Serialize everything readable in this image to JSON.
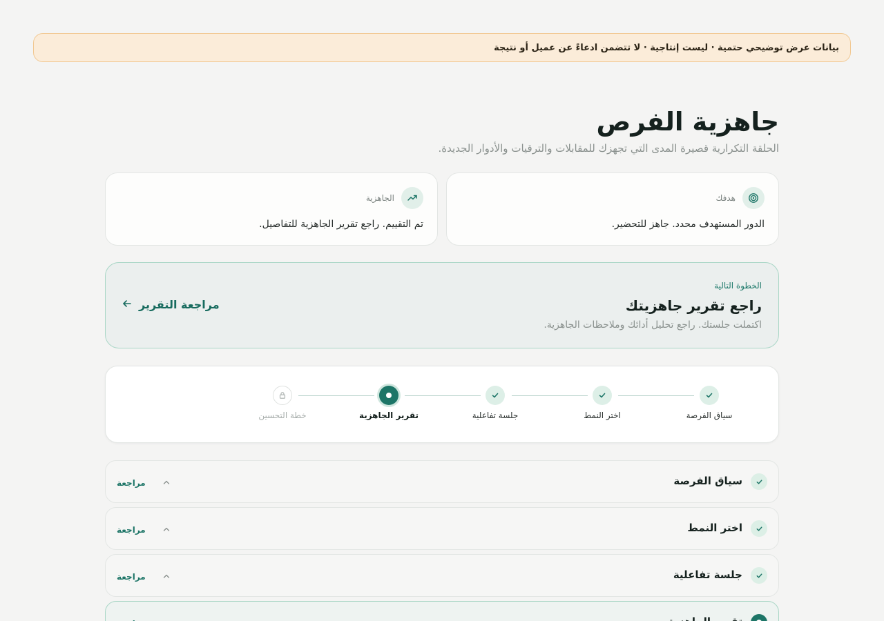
{
  "banner": {
    "text": "بيانات عرض توضيحي حتمية · ليست إنتاجية · لا تتضمن ادعاءً عن عميل أو نتيجة"
  },
  "header": {
    "title": "جاهزية الفرص",
    "subtitle": "الحلقة التكرارية قصيرة المدى التي تجهزك للمقابلات والترقيات والأدوار الجديدة."
  },
  "cards": {
    "goal": {
      "label": "هدفك",
      "body": "الدور المستهدف محدد. جاهز للتحضير.",
      "icon": "target-icon"
    },
    "readiness": {
      "label": "الجاهزية",
      "body": "تم التقييم. راجع تقرير الجاهزية للتفاصيل.",
      "icon": "trending-up-icon"
    }
  },
  "next_step": {
    "eyebrow": "الخطوة التالية",
    "title": "راجع تقرير جاهزيتك",
    "description": "اكتملت جلستك. راجع تحليل أدائك وملاحظات الجاهزية.",
    "action_label": "مراجعة التقرير"
  },
  "stepper": {
    "steps": [
      {
        "label": "سياق الفرصة",
        "state": "done"
      },
      {
        "label": "اختر النمط",
        "state": "done"
      },
      {
        "label": "جلسة تفاعلية",
        "state": "done"
      },
      {
        "label": "تقرير الجاهزية",
        "state": "active"
      },
      {
        "label": "خطة التحسين",
        "state": "locked"
      }
    ]
  },
  "accordion": {
    "toggle_label": "مراجعة",
    "rows": [
      {
        "title": "سياق الفرصة"
      },
      {
        "title": "اختر النمط"
      },
      {
        "title": "جلسة تفاعلية"
      },
      {
        "title": "تقرير الجاهزية"
      }
    ]
  },
  "colors": {
    "accent": "#1d7567",
    "banner_bg": "#fbecd9",
    "background": "#f4f4f3"
  }
}
